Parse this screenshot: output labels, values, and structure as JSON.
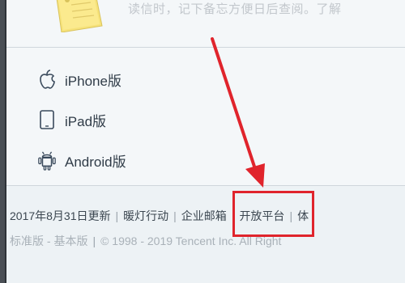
{
  "memo": {
    "text": "读信时，记下备忘方便日后查阅。了解",
    "icon": "sticky-note-icon"
  },
  "apps": [
    {
      "label": "iPhone版",
      "icon": "apple-icon"
    },
    {
      "label": "iPad版",
      "icon": "tablet-icon"
    },
    {
      "label": "Android版",
      "icon": "android-icon"
    }
  ],
  "footer": {
    "update": "2017年8月31日更新",
    "link1": "暖灯行动",
    "link2": "企业邮箱",
    "link3": "开放平台",
    "link4": "体",
    "standard": "标准版",
    "dash": " - ",
    "basic": "基本版",
    "copyright": "© 1998 - 2019 Tencent Inc. All Right"
  },
  "colors": {
    "highlight": "#e0242c",
    "arrow": "#e0242c"
  }
}
